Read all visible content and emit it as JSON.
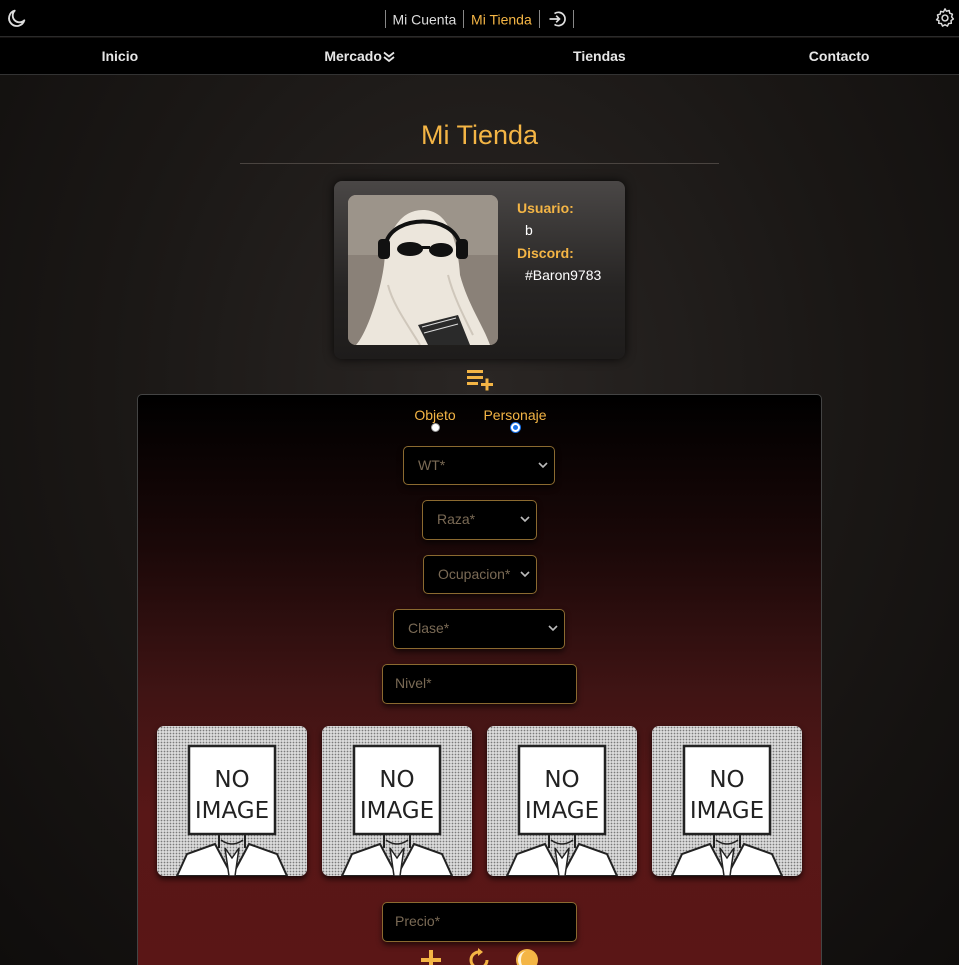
{
  "top_bar": {
    "account_link": "Mi Cuenta",
    "store_link": "Mi Tienda",
    "icons": [
      "moon-icon",
      "logout-icon",
      "gear-icon"
    ]
  },
  "nav": {
    "items": [
      "Inicio",
      "Mercado",
      "Tiendas",
      "Contacto"
    ]
  },
  "page": {
    "title": "Mi Tienda"
  },
  "profile": {
    "user_label": "Usuario:",
    "user_value": "b",
    "discord_label": "Discord:",
    "discord_value": "#Baron9783"
  },
  "form": {
    "type_options": [
      "Objeto",
      "Personaje"
    ],
    "selected_type": "Personaje",
    "wt_placeholder": "WT*",
    "race_placeholder": "Raza*",
    "occupation_placeholder": "Ocupacion*",
    "class_placeholder": "Clase*",
    "level_placeholder": "Nivel*",
    "price_placeholder": "Precio*",
    "image_slots": [
      {
        "line1": "NO",
        "line2": "IMAGE"
      },
      {
        "line1": "NO",
        "line2": "IMAGE"
      },
      {
        "line1": "NO",
        "line2": "IMAGE"
      },
      {
        "line1": "NO",
        "line2": "IMAGE"
      }
    ]
  },
  "colors": {
    "accent": "#f4b545",
    "bar_bg": "#000000",
    "panel_red": "#5a1616"
  }
}
